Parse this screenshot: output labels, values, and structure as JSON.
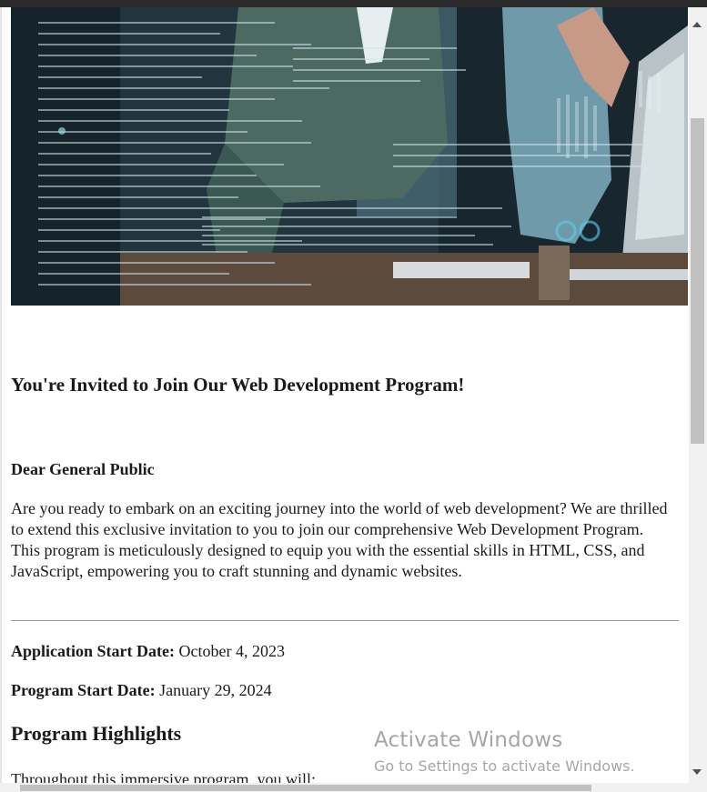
{
  "hero": {
    "image": "people-at-computer-with-code-overlay"
  },
  "invitation": {
    "title": "You're Invited to Join Our Web Development Program!",
    "salutation": "Dear General Public",
    "intro": "Are you ready to embark on an exciting journey into the world of web development? We are thrilled to extend this exclusive invitation to you to join our comprehensive Web Development Program. This program is meticulously designed to equip you with the essential skills in HTML, CSS, and JavaScript, empowering you to craft stunning and dynamic websites.",
    "application_label": "Application Start Date:",
    "application_value": " October 4, 2023",
    "program_label": "Program Start Date:",
    "program_value": " January 29, 2024",
    "highlights_heading": "Program Highlights",
    "highlights_intro": "Throughout this immersive program, you will:"
  },
  "watermark": {
    "title": "Activate Windows",
    "subtitle": "Go to Settings to activate Windows."
  },
  "colors": {
    "text": "#1a1a1a",
    "rule": "#9a9a9a",
    "watermark": "#969696",
    "scroll_thumb": "#c1c1c1"
  }
}
